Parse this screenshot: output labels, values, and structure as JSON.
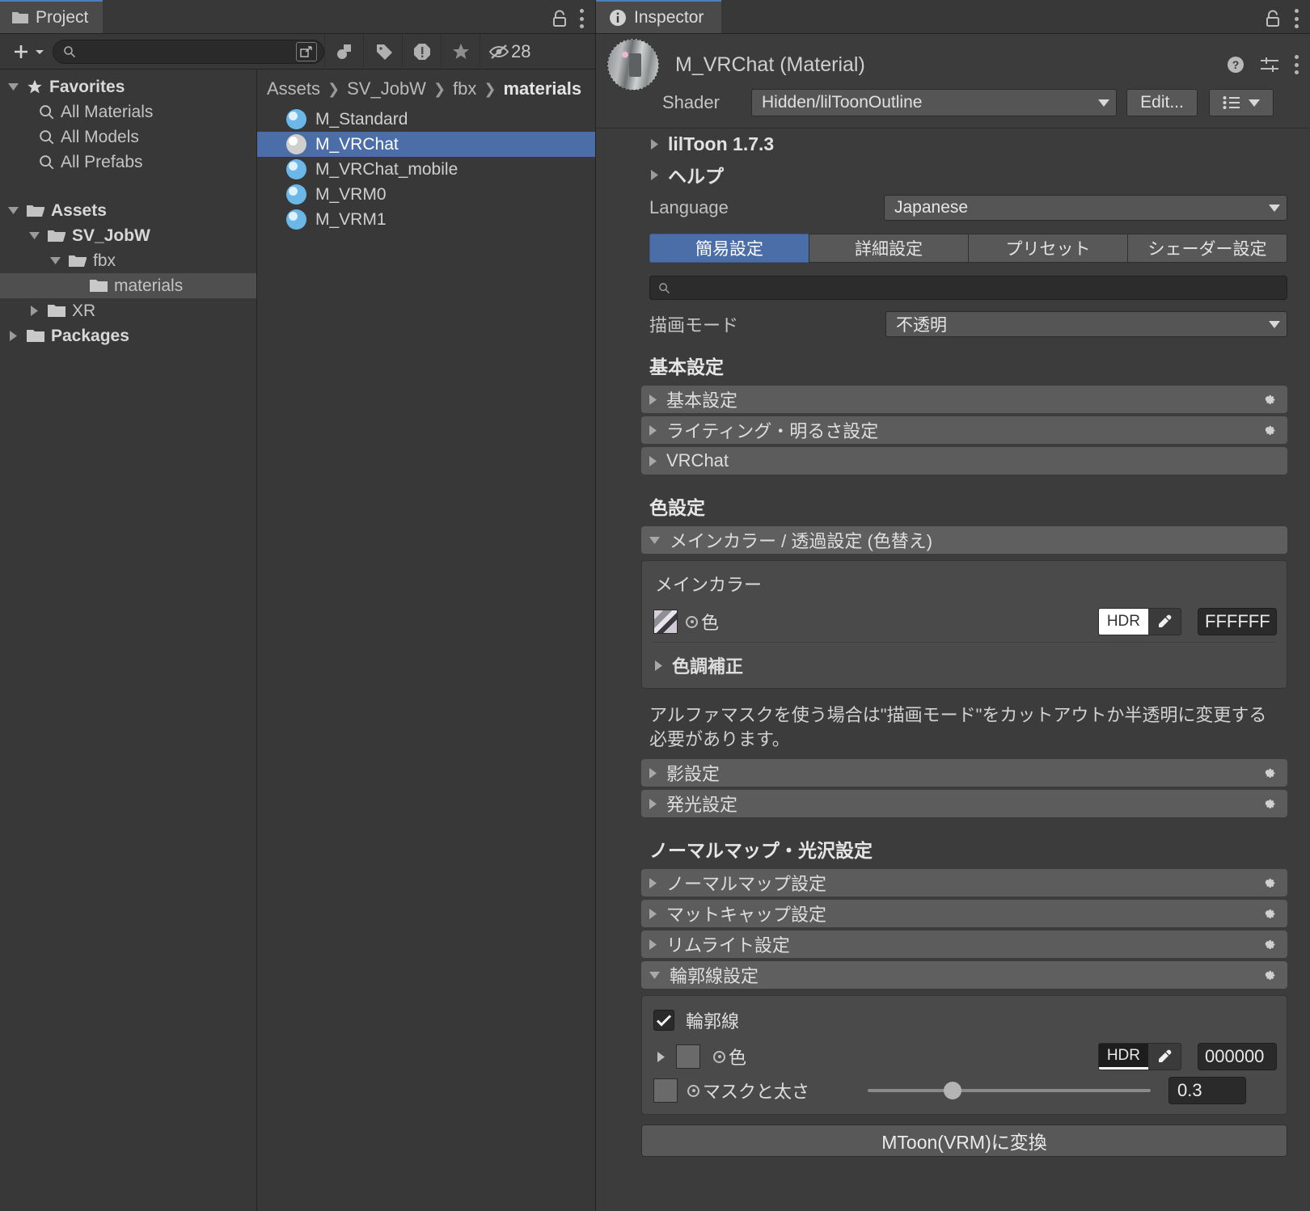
{
  "project_panel": {
    "tab_label": "Project",
    "toolbar": {
      "add_label": "+",
      "search_value": "",
      "search_placeholder": "",
      "visibility_count": "28"
    },
    "tree": [
      {
        "label": "Favorites",
        "icon": "star-icon",
        "depth": 0,
        "expanded": true,
        "bold": true,
        "selected": false
      },
      {
        "label": "All Materials",
        "icon": "search-icon",
        "depth": 1,
        "expanded": null,
        "bold": false,
        "selected": false
      },
      {
        "label": "All Models",
        "icon": "search-icon",
        "depth": 1,
        "expanded": null,
        "bold": false,
        "selected": false
      },
      {
        "label": "All Prefabs",
        "icon": "search-icon",
        "depth": 1,
        "expanded": null,
        "bold": false,
        "selected": false
      },
      {
        "label": "",
        "icon": "none",
        "depth": 0,
        "expanded": null,
        "bold": false,
        "selected": false
      },
      {
        "label": "Assets",
        "icon": "folder-open-icon",
        "depth": 0,
        "expanded": true,
        "bold": true,
        "selected": false
      },
      {
        "label": "SV_JobW",
        "icon": "folder-open-icon",
        "depth": 1,
        "expanded": true,
        "bold": true,
        "selected": false
      },
      {
        "label": "fbx",
        "icon": "folder-open-icon",
        "depth": 2,
        "expanded": true,
        "bold": false,
        "selected": false
      },
      {
        "label": "materials",
        "icon": "folder-icon",
        "depth": 3,
        "expanded": null,
        "bold": false,
        "selected": true
      },
      {
        "label": "XR",
        "icon": "folder-icon",
        "depth": 1,
        "expanded": false,
        "bold": false,
        "selected": false
      },
      {
        "label": "Packages",
        "icon": "folder-icon",
        "depth": 0,
        "expanded": false,
        "bold": true,
        "selected": false
      }
    ],
    "breadcrumb": [
      "Assets",
      "SV_JobW",
      "fbx",
      "materials"
    ],
    "assets": [
      {
        "name": "M_Standard",
        "selected": false
      },
      {
        "name": "M_VRChat",
        "selected": true
      },
      {
        "name": "M_VRChat_mobile",
        "selected": false
      },
      {
        "name": "M_VRM0",
        "selected": false
      },
      {
        "name": "M_VRM1",
        "selected": false
      }
    ]
  },
  "inspector": {
    "tab_label": "Inspector",
    "material_title": "M_VRChat (Material)",
    "shader_label": "Shader",
    "shader_value": "Hidden/lilToonOutline",
    "edit_label": "Edit...",
    "version_label": "lilToon 1.7.3",
    "help_label": "ヘルプ",
    "language_label": "Language",
    "language_value": "Japanese",
    "tabs": [
      {
        "label": "簡易設定",
        "active": true
      },
      {
        "label": "詳細設定",
        "active": false
      },
      {
        "label": "プリセット",
        "active": false
      },
      {
        "label": "シェーダー設定",
        "active": false
      }
    ],
    "search_value": "",
    "search_placeholder": "",
    "render_mode_label": "描画モード",
    "render_mode_value": "不透明",
    "groups": [
      {
        "title": "基本設定",
        "rows": [
          {
            "label": "基本設定",
            "expanded": false,
            "gear": true
          },
          {
            "label": "ライティング・明るさ設定",
            "expanded": false,
            "gear": true
          },
          {
            "label": "VRChat",
            "expanded": false,
            "gear": false
          }
        ]
      }
    ],
    "color_section": {
      "title": "色設定",
      "main_bar_label": "メインカラー / 透過設定 (色替え)",
      "sub_title": "メインカラー",
      "color_row_label": "色",
      "hdr_label": "HDR",
      "hex_value": "FFFFFF",
      "tone_fold_label": "色調補正",
      "alpha_note": "アルファマスクを使う場合は\"描画モード\"をカットアウトか半透明に変更する必要があります。",
      "extra_rows": [
        {
          "label": "影設定",
          "expanded": false,
          "gear": true
        },
        {
          "label": "発光設定",
          "expanded": false,
          "gear": true
        }
      ]
    },
    "normal_section": {
      "title": "ノーマルマップ・光沢設定",
      "rows": [
        {
          "label": "ノーマルマップ設定",
          "expanded": false,
          "gear": true
        },
        {
          "label": "マットキャップ設定",
          "expanded": false,
          "gear": true
        },
        {
          "label": "リムライト設定",
          "expanded": false,
          "gear": true
        },
        {
          "label": "輪郭線設定",
          "expanded": true,
          "gear": true
        }
      ]
    },
    "outline": {
      "checkbox_label": "輪郭線",
      "checked": true,
      "color_label": "色",
      "hdr_label": "HDR",
      "hex_value": "000000",
      "mask_label": "マスクと太さ",
      "mask_value": "0.3",
      "mask_slider_pct": 30
    },
    "convert_button": "MToon(VRM)に変換",
    "accent_color": "#4b6ea9"
  }
}
